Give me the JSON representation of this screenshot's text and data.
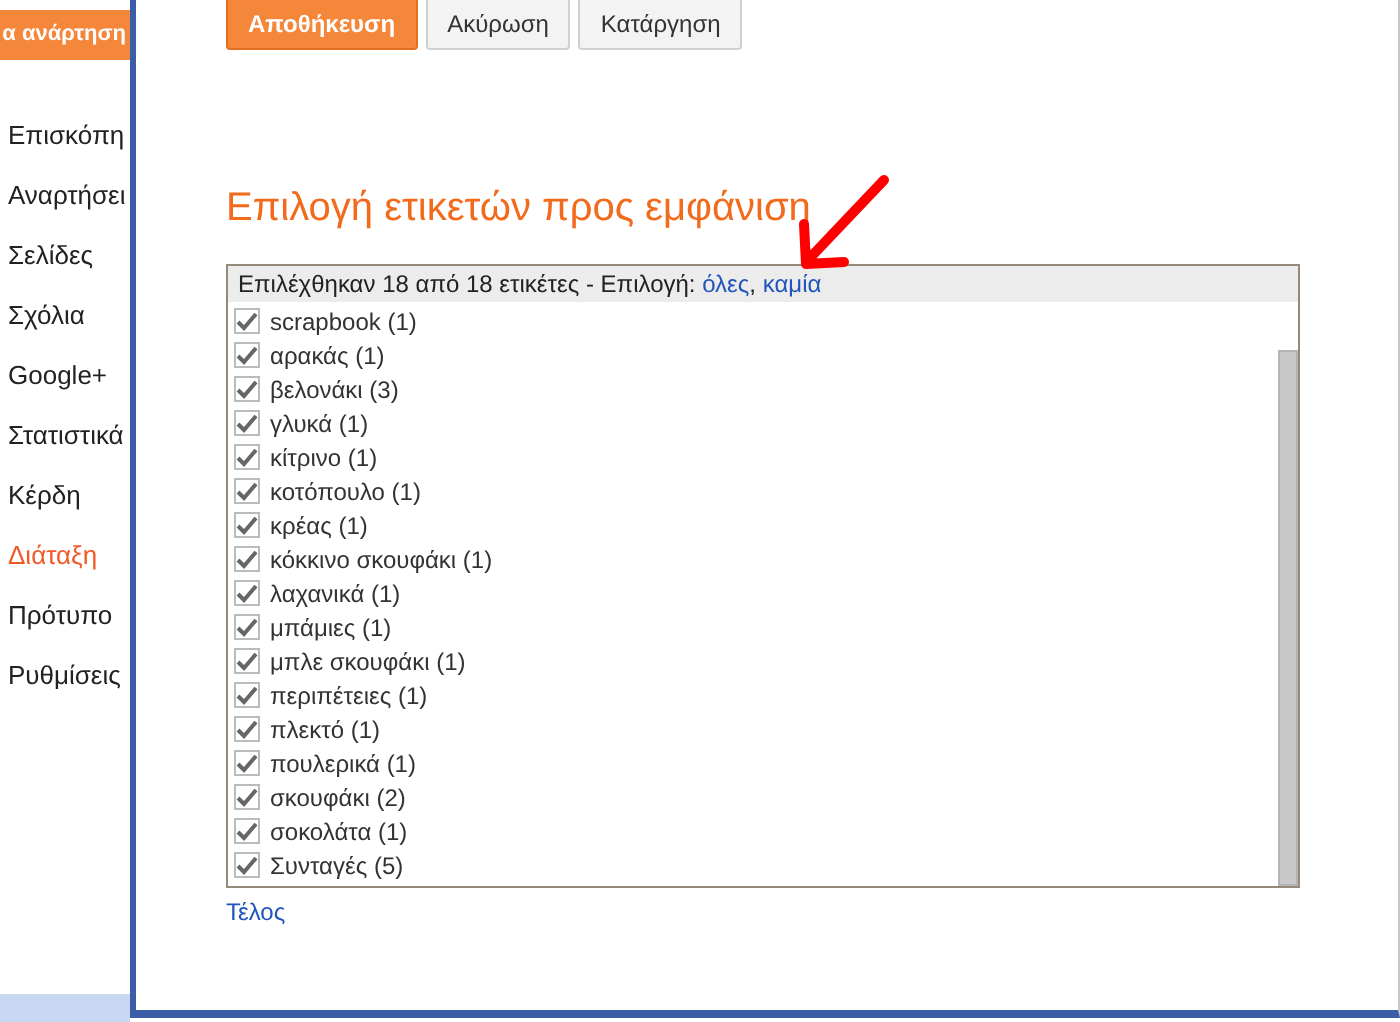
{
  "sidebar": {
    "new_post_button": "α ανάρτηση",
    "items": [
      {
        "label": "Επισκόπη",
        "selected": false
      },
      {
        "label": "Αναρτήσει",
        "selected": false
      },
      {
        "label": "Σελίδες",
        "selected": false
      },
      {
        "label": "Σχόλια",
        "selected": false
      },
      {
        "label": "Google+",
        "selected": false
      },
      {
        "label": "Στατιστικά",
        "selected": false
      },
      {
        "label": "Κέρδη",
        "selected": false
      },
      {
        "label": "Διάταξη",
        "selected": true
      },
      {
        "label": "Πρότυπο",
        "selected": false
      },
      {
        "label": "Ρυθμίσεις",
        "selected": false
      }
    ]
  },
  "dialog": {
    "buttons": [
      {
        "label": "Αποθήκευση",
        "kind": "primary"
      },
      {
        "label": "Ακύρωση",
        "kind": "secondary"
      },
      {
        "label": "Κατάργηση",
        "kind": "secondary"
      }
    ],
    "heading": "Επιλογή ετικετών προς εμφάνιση",
    "label_list": {
      "summary": "Επιλέχθηκαν 18 από 18 ετικέτες - Επιλογή:",
      "links": [
        "όλες",
        "καμία"
      ],
      "separator": ",",
      "items": [
        {
          "label": "scrapbook (1)",
          "checked": true
        },
        {
          "label": "αρακάς (1)",
          "checked": true
        },
        {
          "label": "βελονάκι (3)",
          "checked": true
        },
        {
          "label": "γλυκά (1)",
          "checked": true
        },
        {
          "label": "κίτρινο (1)",
          "checked": true
        },
        {
          "label": "κοτόπουλο (1)",
          "checked": true
        },
        {
          "label": "κρέας (1)",
          "checked": true
        },
        {
          "label": "κόκκινο σκουφάκι (1)",
          "checked": true
        },
        {
          "label": "λαχανικά (1)",
          "checked": true
        },
        {
          "label": "μπάμιες (1)",
          "checked": true
        },
        {
          "label": "μπλε σκουφάκι (1)",
          "checked": true
        },
        {
          "label": "περιπέτειες (1)",
          "checked": true
        },
        {
          "label": "πλεκτό (1)",
          "checked": true
        },
        {
          "label": "πουλερικά (1)",
          "checked": true
        },
        {
          "label": "σκουφάκι (2)",
          "checked": true
        },
        {
          "label": "σοκολάτα (1)",
          "checked": true
        },
        {
          "label": "Συνταγές (5)",
          "checked": true
        }
      ]
    },
    "done_link": "Τέλος"
  }
}
